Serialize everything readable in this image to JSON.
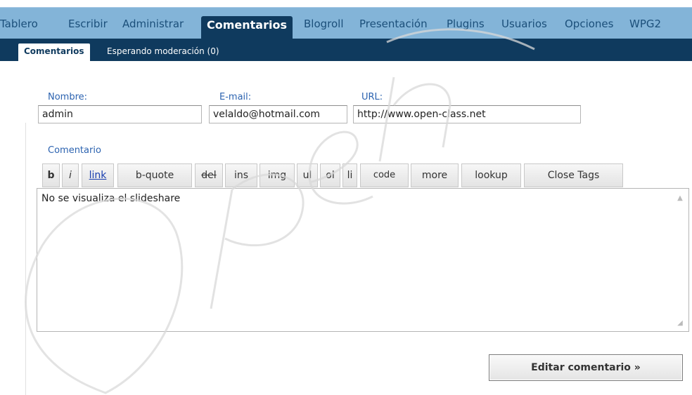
{
  "nav": {
    "items": [
      {
        "label": "Tablero"
      },
      {
        "label": "Escribir"
      },
      {
        "label": "Administrar"
      },
      {
        "label": "Comentarios",
        "active": true
      },
      {
        "label": "Blogroll"
      },
      {
        "label": "Presentación"
      },
      {
        "label": "Plugins"
      },
      {
        "label": "Usuarios"
      },
      {
        "label": "Opciones"
      },
      {
        "label": "WPG2"
      }
    ]
  },
  "subnav": {
    "items": [
      {
        "label": "Comentarios",
        "active": true
      },
      {
        "label": "Esperando moderación (0)"
      }
    ]
  },
  "form": {
    "name_label": "Nombre:",
    "name_value": "admin",
    "email_label": "E-mail:",
    "email_value": "velaldo@hotmail.com",
    "url_label": "URL:",
    "url_value": "http://www.open-class.net",
    "comment_label": "Comentario",
    "comment_value": "No se visualiza el slideshare",
    "submit_label": "Editar comentario »"
  },
  "quicktags": [
    "b",
    "i",
    "link",
    "b-quote",
    "del",
    "ins",
    "img",
    "ul",
    "ol",
    "li",
    "code",
    "more",
    "lookup",
    "Close Tags"
  ],
  "watermark": {
    "text": "Open"
  },
  "colors": {
    "nav_bg": "#83b4d8",
    "nav_active_bg": "#0f3a5e",
    "label_blue": "#2c63b0"
  }
}
